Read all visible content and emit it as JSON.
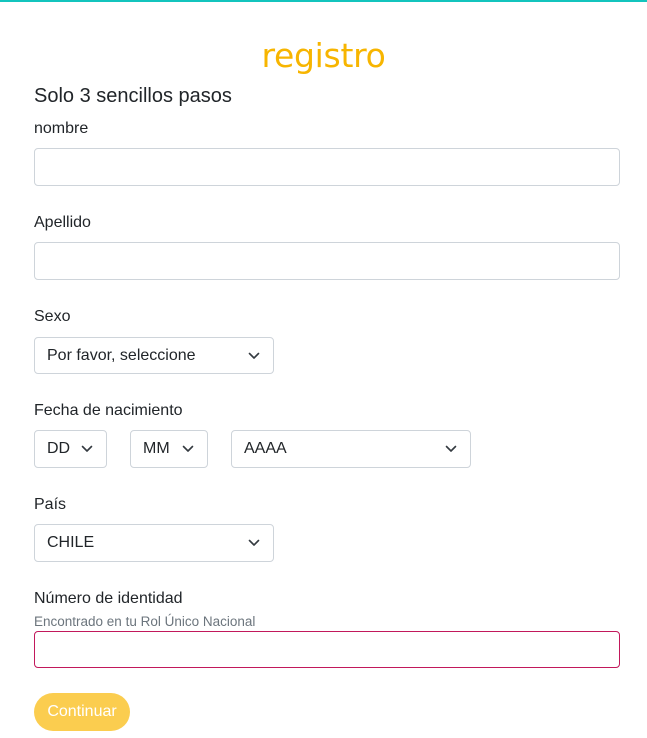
{
  "header": {
    "logo_text": "registro",
    "subtitle": "Solo 3 sencillos pasos"
  },
  "form": {
    "nombre": {
      "label": "nombre",
      "value": ""
    },
    "apellido": {
      "label": "Apellido",
      "value": ""
    },
    "sexo": {
      "label": "Sexo",
      "selected": "Por favor, seleccione"
    },
    "fecha": {
      "label": "Fecha de nacimiento",
      "day": "DD",
      "month": "MM",
      "year": "AAAA"
    },
    "pais": {
      "label": "País",
      "selected": "CHILE"
    },
    "identidad": {
      "label": "Número de identidad",
      "hint": "Encontrado en tu Rol Único Nacional",
      "value": ""
    },
    "submit_label": "Continuar"
  },
  "colors": {
    "accent": "#f7b500",
    "button": "#fbcd4f",
    "top_line": "#13c4bd",
    "invalid_border": "#c2185b"
  },
  "icons": {
    "select_chevron": "chevron-down-icon"
  }
}
